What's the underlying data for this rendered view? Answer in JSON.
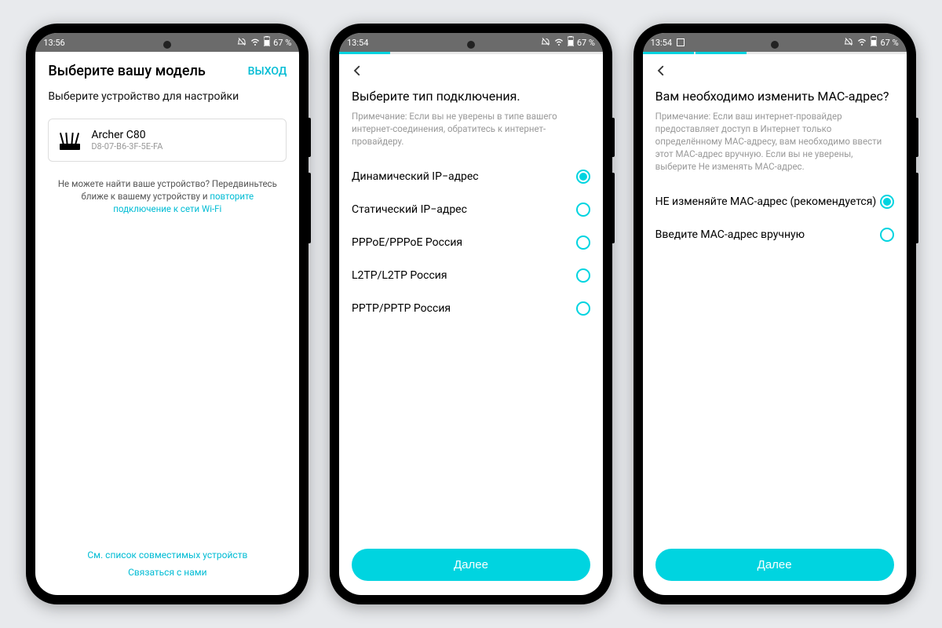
{
  "status": {
    "time1": "13:56",
    "time2": "13:54",
    "time3": "13:54",
    "battery": "67 %"
  },
  "screen1": {
    "title": "Выберите вашу модель",
    "exit": "ВЫХОД",
    "subtitle": "Выберите устройство для настройки",
    "device_name": "Archer C80",
    "device_mac": "D8-07-B6-3F-5E-FA",
    "help_prefix": "Не можете найти ваше устройство? Передвиньтесь ближе к вашему устройству и ",
    "help_link": "повторите подключение к сети Wi-Fi",
    "footer1": "См. список совместимых устройств",
    "footer2": "Связаться с нами"
  },
  "screen2": {
    "title": "Выберите тип подключения.",
    "note": "Примечание: Если вы не уверены в типе вашего интернет-соединения, обратитесь к интернет-провайдеру.",
    "options": [
      {
        "label": "Динамический IP−адрес",
        "selected": true
      },
      {
        "label": "Статический IP−адрес",
        "selected": false
      },
      {
        "label": "PPPoE/PPPoE Россия",
        "selected": false
      },
      {
        "label": "L2TP/L2TP Россия",
        "selected": false
      },
      {
        "label": "PPTP/PPTP Россия",
        "selected": false
      }
    ],
    "next": "Далее"
  },
  "screen3": {
    "title": "Вам необходимо изменить MAC-адрес?",
    "note": "Примечание: Если ваш интернет-провайдер предоставляет доступ в Интернет только определённому MAC-адресу, вам необходимо ввести этот MAC-адрес вручную. Если вы не уверены, выберите Не изменять MAC-адрес.",
    "options": [
      {
        "label": "НЕ изменяйте MAC-адрес (рекомендуется)",
        "selected": true
      },
      {
        "label": "Введите MAC-адрес вручную",
        "selected": false
      }
    ],
    "next": "Далее"
  }
}
